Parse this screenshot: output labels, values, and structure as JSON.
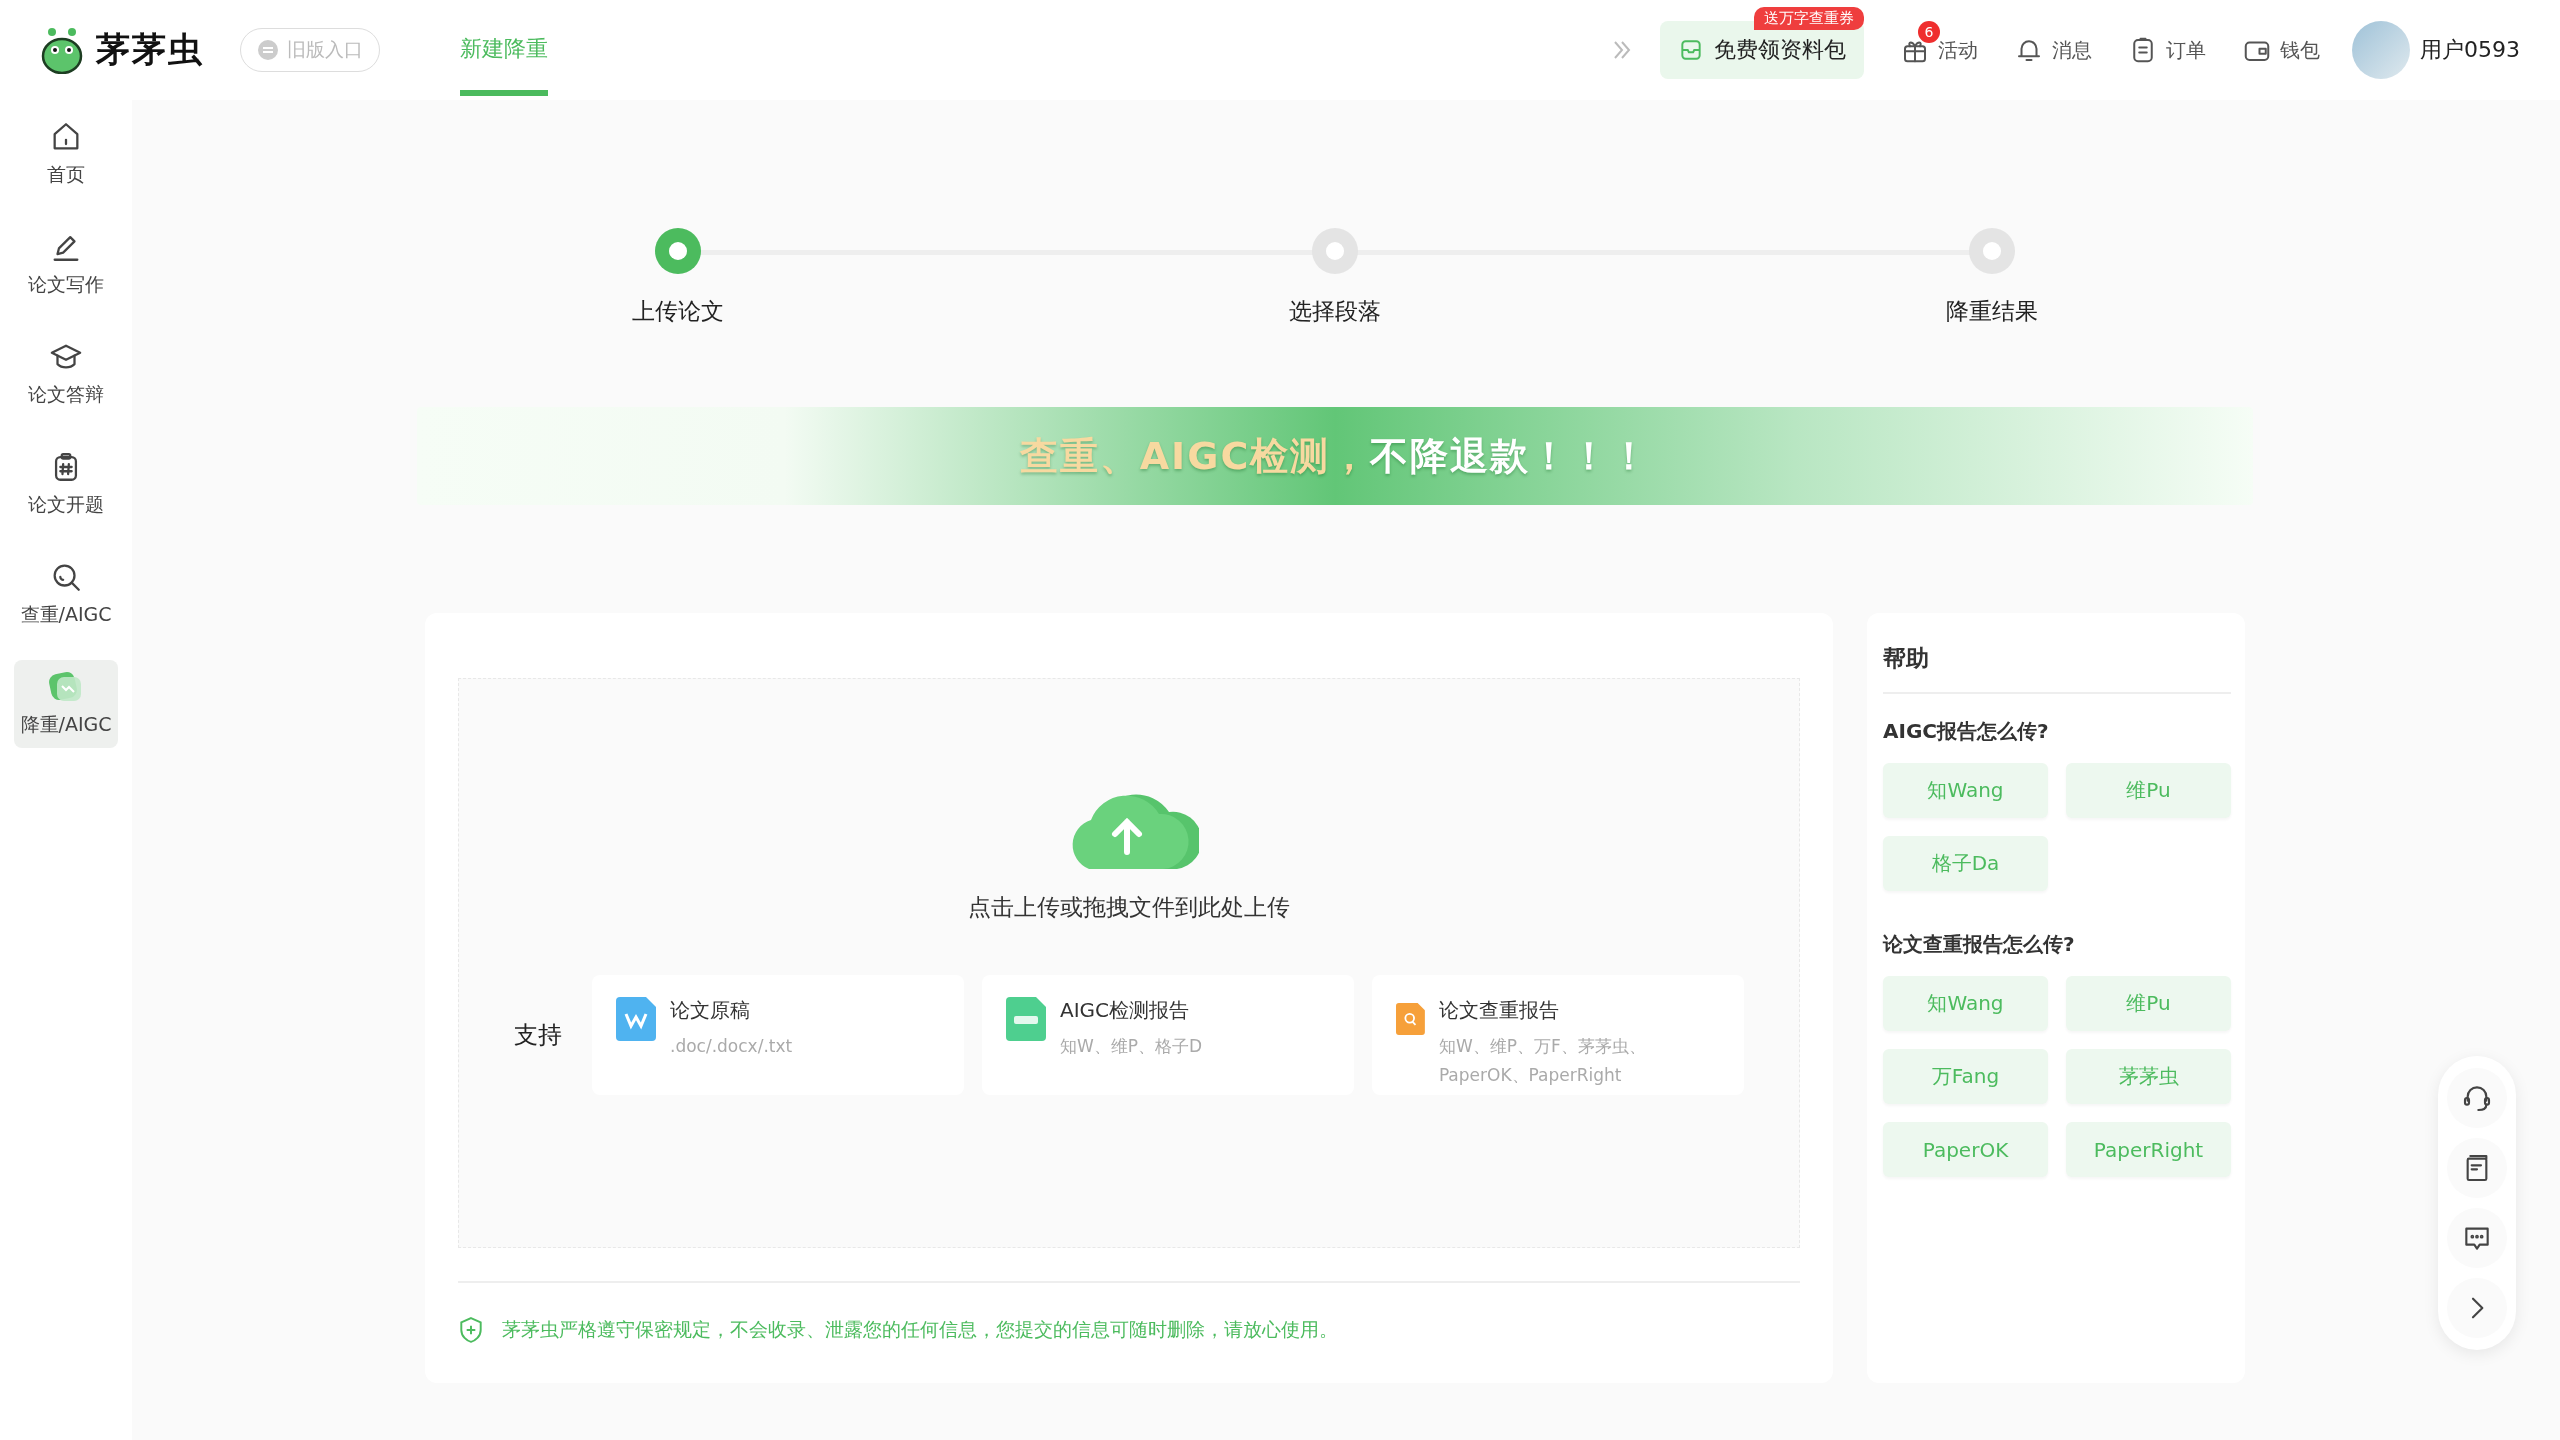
{
  "header": {
    "brand": "茅茅虫",
    "old_entry": "旧版入口",
    "tabs": [
      {
        "label": "新建降重",
        "selected": true
      }
    ],
    "promo": {
      "label": "免费领资料包",
      "badge": "送万字查重券"
    },
    "actions": [
      {
        "kind": "gift",
        "label": "活动",
        "badge": "6"
      },
      {
        "kind": "bell",
        "label": "消息"
      },
      {
        "kind": "clipboard",
        "label": "订单"
      },
      {
        "kind": "wallet",
        "label": "钱包"
      }
    ],
    "user": "用户0593"
  },
  "sidebar": {
    "items": [
      {
        "kind": "home",
        "label": "首页",
        "selected": false
      },
      {
        "kind": "pen",
        "label": "论文写作",
        "selected": false
      },
      {
        "kind": "cap",
        "label": "论文答辩",
        "selected": false
      },
      {
        "kind": "hash",
        "label": "论文开题",
        "selected": false
      },
      {
        "kind": "search",
        "label": "查重/AIGC",
        "selected": false
      },
      {
        "kind": "reduce",
        "label": "降重/AIGC",
        "selected": true
      }
    ]
  },
  "steps": [
    {
      "label": "上传论文",
      "selected": true
    },
    {
      "label": "选择段落",
      "selected": false
    },
    {
      "label": "降重结果",
      "selected": false
    }
  ],
  "banner": [
    {
      "kind": "gold",
      "text": "查重、AIGC检测，"
    },
    {
      "kind": "white",
      "text": "不降退款！！！"
    }
  ],
  "upload": {
    "prompt": "点击上传或拖拽文件到此处上传",
    "support_label": "支持",
    "formats": [
      {
        "kind": "word",
        "title": "论文原稿",
        "detail": ".doc/.docx/.txt"
      },
      {
        "kind": "aigc",
        "title": "AIGC检测报告",
        "detail": "知W、维P、格子D"
      },
      {
        "kind": "check",
        "title": "论文查重报告",
        "detail": "知W、维P、万F、茅茅虫、PaperOK、PaperRight"
      }
    ],
    "notice": "茅茅虫严格遵守保密规定，不会收录、泄露您的任何信息，您提交的信息可随时删除，请放心使用。"
  },
  "help": {
    "title": "帮助",
    "sections": [
      {
        "question": "AIGC报告怎么传?",
        "links": [
          "知Wang",
          "维Pu",
          "格子Da"
        ]
      },
      {
        "question": "论文查重报告怎么传?",
        "links": [
          "知Wang",
          "维Pu",
          "万Fang",
          "茅茅虫",
          "PaperOK",
          "PaperRight"
        ]
      }
    ]
  },
  "float_toolbar": [
    {
      "kind": "headset"
    },
    {
      "kind": "book"
    },
    {
      "kind": "chat"
    },
    {
      "kind": "chevron"
    }
  ]
}
